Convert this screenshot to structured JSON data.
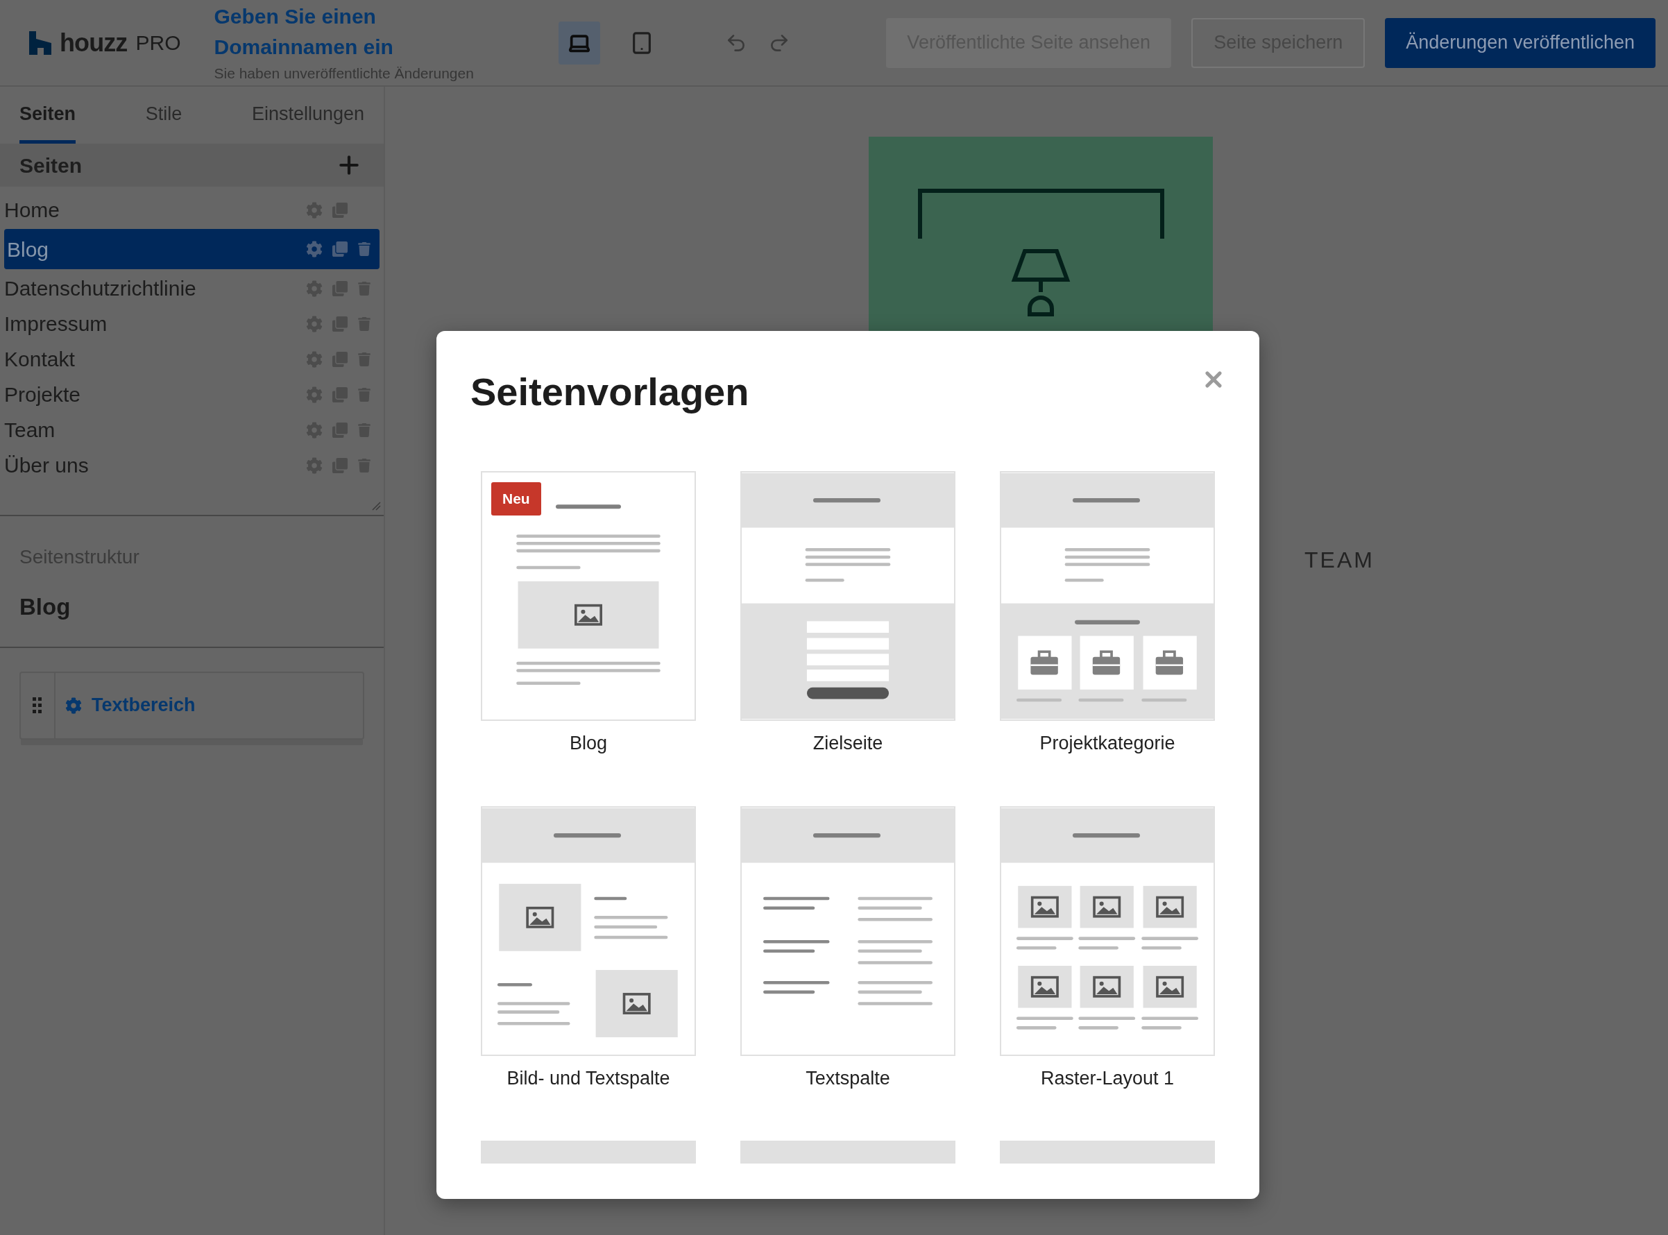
{
  "header": {
    "logo": {
      "brand": "houzz",
      "suffix": "PRO"
    },
    "domain_link": "Geben Sie einen Domainnamen ein",
    "status": "Sie haben unveröffentlichte Änderungen",
    "devices": [
      {
        "kind": "desktop",
        "selected": true
      },
      {
        "kind": "tablet",
        "selected": false
      }
    ],
    "buttons": [
      {
        "label": "Veröffentlichte Seite ansehen",
        "kind": "muted"
      },
      {
        "label": "Seite speichern",
        "kind": "outline"
      },
      {
        "label": "Änderungen veröffentlichen",
        "kind": "primary"
      }
    ]
  },
  "sidebar": {
    "tabs": [
      {
        "label": "Seiten",
        "selected": true
      },
      {
        "label": "Stile",
        "selected": false
      },
      {
        "label": "Einstellungen",
        "selected": false
      }
    ],
    "pages_header": "Seiten",
    "pages": [
      {
        "name": "Home",
        "selected": false,
        "deletable": false
      },
      {
        "name": "Blog",
        "selected": true,
        "deletable": true
      },
      {
        "name": "Datenschutzrichtlinie",
        "selected": false,
        "deletable": true
      },
      {
        "name": "Impressum",
        "selected": false,
        "deletable": true
      },
      {
        "name": "Kontakt",
        "selected": false,
        "deletable": true
      },
      {
        "name": "Projekte",
        "selected": false,
        "deletable": true
      },
      {
        "name": "Team",
        "selected": false,
        "deletable": true
      },
      {
        "name": "Über uns",
        "selected": false,
        "deletable": true
      }
    ],
    "structure": {
      "label": "Seitenstruktur",
      "page": "Blog",
      "sections": [
        {
          "label": "Textbereich"
        }
      ]
    }
  },
  "canvas": {
    "nav_item": "TEAM"
  },
  "modal": {
    "title": "Seitenvorlagen",
    "templates": [
      {
        "name": "Blog",
        "kind": "blog",
        "badge": "Neu"
      },
      {
        "name": "Zielseite",
        "kind": "landing"
      },
      {
        "name": "Projektkategorie",
        "kind": "category"
      },
      {
        "name": "Bild- und Textspalte",
        "kind": "image-text"
      },
      {
        "name": "Textspalte",
        "kind": "text"
      },
      {
        "name": "Raster-Layout 1",
        "kind": "grid"
      }
    ]
  }
}
